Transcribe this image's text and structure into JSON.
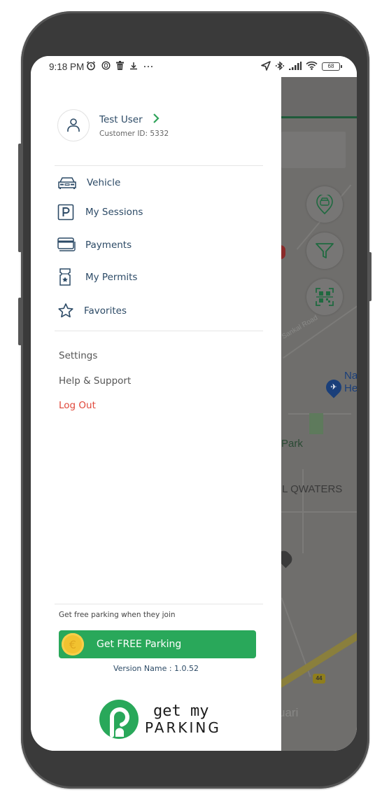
{
  "status_bar": {
    "time": "9:18 PM",
    "left_icons": [
      "alarm-icon",
      "messenger-icon",
      "trash-icon",
      "download-icon",
      "more-dots-icon"
    ],
    "right_icons": [
      "location-icon",
      "bluetooth-icon",
      "signal-icon",
      "wifi-icon",
      "battery-icon"
    ],
    "battery_level": "68"
  },
  "drawer": {
    "profile": {
      "name": "Test User",
      "customer_id": "Customer ID: 5332"
    },
    "menu_items": [
      {
        "label": "Vehicle",
        "icon": "car-icon"
      },
      {
        "label": "My Sessions",
        "icon": "parking-icon"
      },
      {
        "label": "Payments",
        "icon": "credit-card-icon"
      },
      {
        "label": "My Permits",
        "icon": "permit-ticket-icon"
      },
      {
        "label": "Favorites",
        "icon": "star-icon"
      }
    ],
    "links": [
      {
        "label": "Settings"
      },
      {
        "label": "Help & Support"
      },
      {
        "label": "Log Out"
      }
    ],
    "invite_text": "Get free parking when they join",
    "free_parking_button": "Get FREE Parking",
    "version": "Version Name : 1.0.52",
    "logo": {
      "line1": "get my",
      "line2": "PARKING"
    }
  },
  "map": {
    "labels": {
      "road": "Sankal Road",
      "poi_partial": "Na\nHe",
      "park": "Park",
      "area": "IL QWATERS",
      "place_partial": "uari",
      "highway": "44"
    },
    "fab_buttons": [
      "vehicle-locate-icon",
      "filter-icon",
      "qr-scan-icon"
    ]
  },
  "colors": {
    "brand_green": "#29a85a",
    "text_navy": "#2c4a66",
    "logout_red": "#e0473a",
    "map_overlay": "#6f6e6c"
  }
}
